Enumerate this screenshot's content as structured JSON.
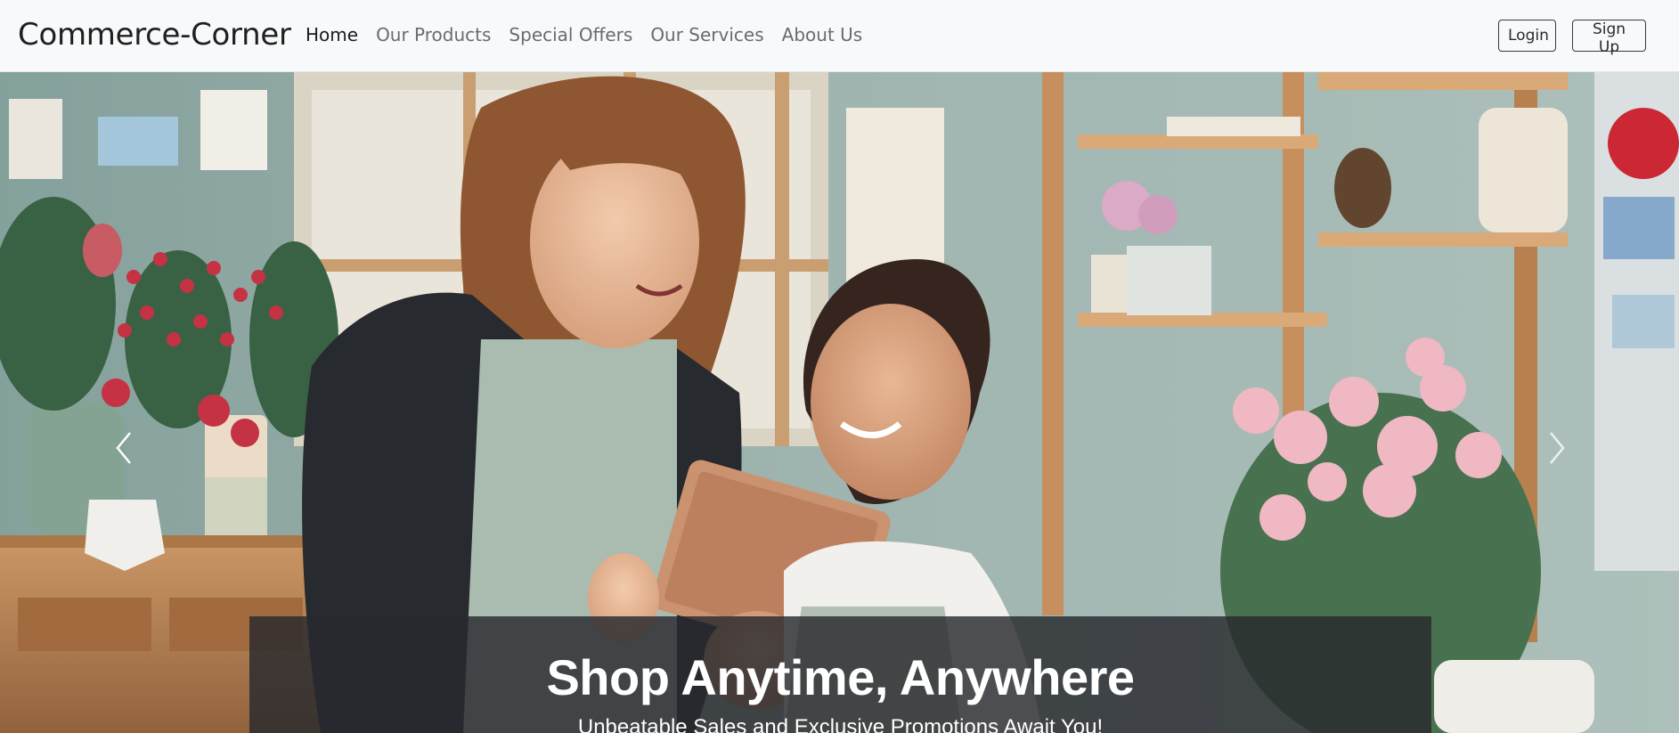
{
  "navbar": {
    "brand": "Commerce-Corner",
    "links": [
      {
        "label": "Home",
        "active": true
      },
      {
        "label": "Our Products",
        "active": false
      },
      {
        "label": "Special Offers",
        "active": false
      },
      {
        "label": "Our Services",
        "active": false
      },
      {
        "label": "About Us",
        "active": false
      }
    ],
    "login_label": "Login",
    "signup_label": "Sign Up"
  },
  "hero": {
    "image_subject": "two-women-florist-shop-tablet-photo",
    "title": "Shop Anytime, Anywhere",
    "subtitle": "Unbeatable Sales and Exclusive Promotions Await You!",
    "prev_icon": "chevron-left-icon",
    "next_icon": "chevron-right-icon"
  },
  "colors": {
    "navbar_bg": "#f8f9fb",
    "caption_bg": "#2a2c2e",
    "text_active": "#1c1c1c",
    "text_muted": "#6b6b6b"
  }
}
